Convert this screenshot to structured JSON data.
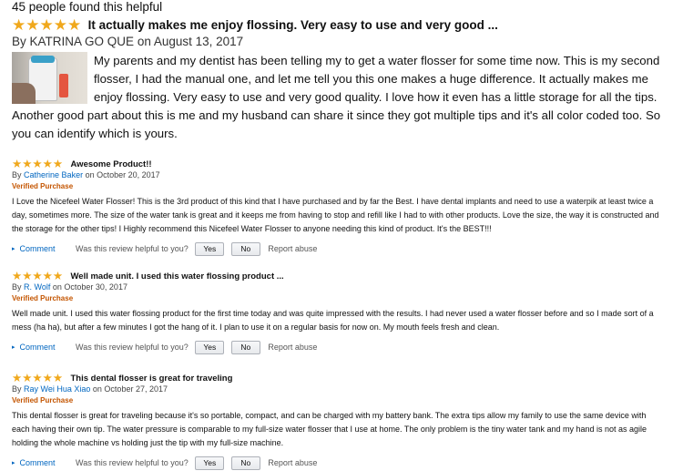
{
  "helpful_count": "45 people found this helpful",
  "featured": {
    "stars": "★★★★★",
    "title": "It actually makes me enjoy flossing. Very easy to use and very good ...",
    "by": "By",
    "author": "KATRINA GO QUE",
    "date": "on August 13, 2017",
    "body": "My parents and my dentist has been telling my to get a water flosser for some time now. This is my second flosser, I had the manual one, and let me tell you this one makes a huge difference. It actually makes me enjoy flossing. Very easy to use and very good quality. I love how it even has a little storage for all the tips. Another good part about this is me and my husband can share it since they got multiple tips and it's all color coded too. So you can identify which is yours."
  },
  "reviews": [
    {
      "stars": "★★★★★",
      "title": "Awesome Product!!",
      "by": "By",
      "author": "Catherine Baker",
      "date": "on October 20, 2017",
      "verified": "Verified Purchase",
      "body": "I Love the Nicefeel Water Flosser! This is the 3rd product of this kind that I have purchased and by far the Best. I have dental implants and need to use a waterpik at least twice a day, sometimes more. The size of the water tank is great and it keeps me from having to stop and refill like I had to with other products. Love the size, the way it is constructed and the storage for the other tips! I Highly recommend this Nicefeel Water Flosser to anyone needing this kind of product. It's the BEST!!!"
    },
    {
      "stars": "★★★★★",
      "title": "Well made unit. I used this water flossing product ...",
      "by": "By",
      "author": "R. Wolf",
      "date": "on October 30, 2017",
      "verified": "Verified Purchase",
      "body": "Well made unit. I used this water flossing product for the first time today and was quite impressed with the results. I had never used a water flosser before and so I made sort of a mess (ha ha), but after a few minutes I got the hang of it. I plan to use it on a regular basis for now on. My mouth feels fresh and clean."
    },
    {
      "stars": "★★★★★",
      "title": "This dental flosser is great for traveling",
      "by": "By",
      "author": "Ray Wei Hua Xiao",
      "date": "on October 27, 2017",
      "verified": "Verified Purchase",
      "body": "This dental flosser is great for traveling because it's so portable, compact, and can be charged with my battery bank. The extra tips allow my family to use the same device with each having their own tip. The water pressure is comparable to my full-size water flosser that I use at home. The only problem is the tiny water tank and my hand is not as agile holding the whole machine vs holding just the tip with my full-size machine."
    }
  ],
  "actions": {
    "comment": "Comment",
    "question": "Was this review helpful to you?",
    "yes": "Yes",
    "no": "No",
    "abuse": "Report abuse"
  },
  "icons": {
    "star": "star-icon",
    "comment_arrow": "caret-right-icon"
  },
  "colors": {
    "star": "#f0a81c",
    "link": "#0066c0",
    "verified": "#c45500"
  }
}
